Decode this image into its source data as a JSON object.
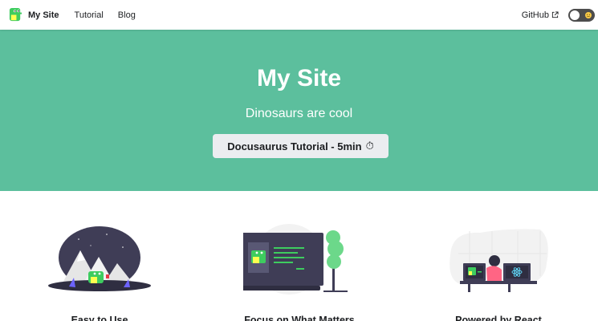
{
  "navbar": {
    "brand_title": "My Site",
    "links": [
      {
        "label": "Tutorial"
      },
      {
        "label": "Blog"
      }
    ],
    "github_label": "GitHub",
    "theme_toggle_icon": "sun-icon"
  },
  "hero": {
    "title": "My Site",
    "subtitle": "Dinosaurs are cool",
    "button_label": "Docusaurus Tutorial - 5min",
    "button_icon": "⏱",
    "background_color": "#5cbf9d"
  },
  "features": [
    {
      "title": "Easy to Use",
      "illustration": "mountain-illustration"
    },
    {
      "title": "Focus on What Matters",
      "illustration": "laptop-tree-illustration"
    },
    {
      "title": "Powered by React",
      "illustration": "react-desk-illustration"
    }
  ]
}
